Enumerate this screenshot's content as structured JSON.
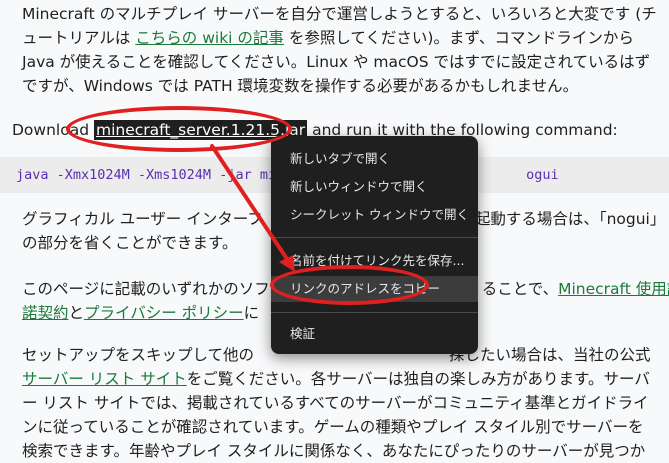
{
  "paragraphs": {
    "p1": {
      "line1": "Minecraft のマルチプレイ サーバーを自分で運営しようとすると、いろいろと大変です (チ",
      "line2_pre": "ュートリアルは ",
      "line2_link": "こちらの wiki の記事",
      "line2_post": " を参照してください)。まず、コマンドラインから",
      "line3": "Java が使えることを確認してください。Linux や macOS ではすでに設定されているはず",
      "line4": "ですが、Windows では PATH 環境変数を操作する必要があるかもしれません。"
    },
    "p2": {
      "pre": "Download ",
      "link": "minecraft_server.1.21.5.jar",
      "post": " and run it with the following command:"
    },
    "code": {
      "part1": "java -Xmx1024M -Xms1024M -jar mi",
      "part2": "ogui"
    },
    "p3": {
      "line1_pre": "グラフィカル ユーザー インターフ",
      "line1_post": "起動する場合は、「nogui」",
      "line2": "の部分を省くことができます。"
    },
    "p4": {
      "line1_pre": "このページに記載のいずれかのソフ",
      "line1_mid": "ることで、",
      "line1_link": "Minecraft 使用許",
      "line2_link1": "諾契約",
      "line2_mid": "と",
      "line2_link2": "プライバシー ポリシー",
      "line2_post": "に"
    },
    "p5": {
      "line1_pre": "セットアップをスキップして他の",
      "line1_post": "探したい場合は、当社の公式",
      "line2_link": "サーバー リスト サイト",
      "line2_post": "をご覧ください。各サーバーは独自の楽しみ方があります。サーバ",
      "line3": "ー リスト サイトでは、掲載されているすべてのサーバーがコミュニティ基準とガイドライ",
      "line4": "ンに従っていることが確認されています。ゲームの種類やプレイ スタイル別でサーバーを",
      "line5": "検索できます。年齢やプレイ スタイルに関係なく、あなたにぴったりのサーバーが見つか"
    }
  },
  "context_menu": {
    "items": [
      "新しいタブで開く",
      "新しいウィンドウで開く",
      "シークレット ウィンドウで開く",
      "名前を付けてリンク先を保存...",
      "リンクのアドレスをコピー",
      "検証"
    ]
  },
  "colors": {
    "link": "#1b7a3a",
    "annotation": "#e02020",
    "menu_bg": "#1f1f1f"
  }
}
